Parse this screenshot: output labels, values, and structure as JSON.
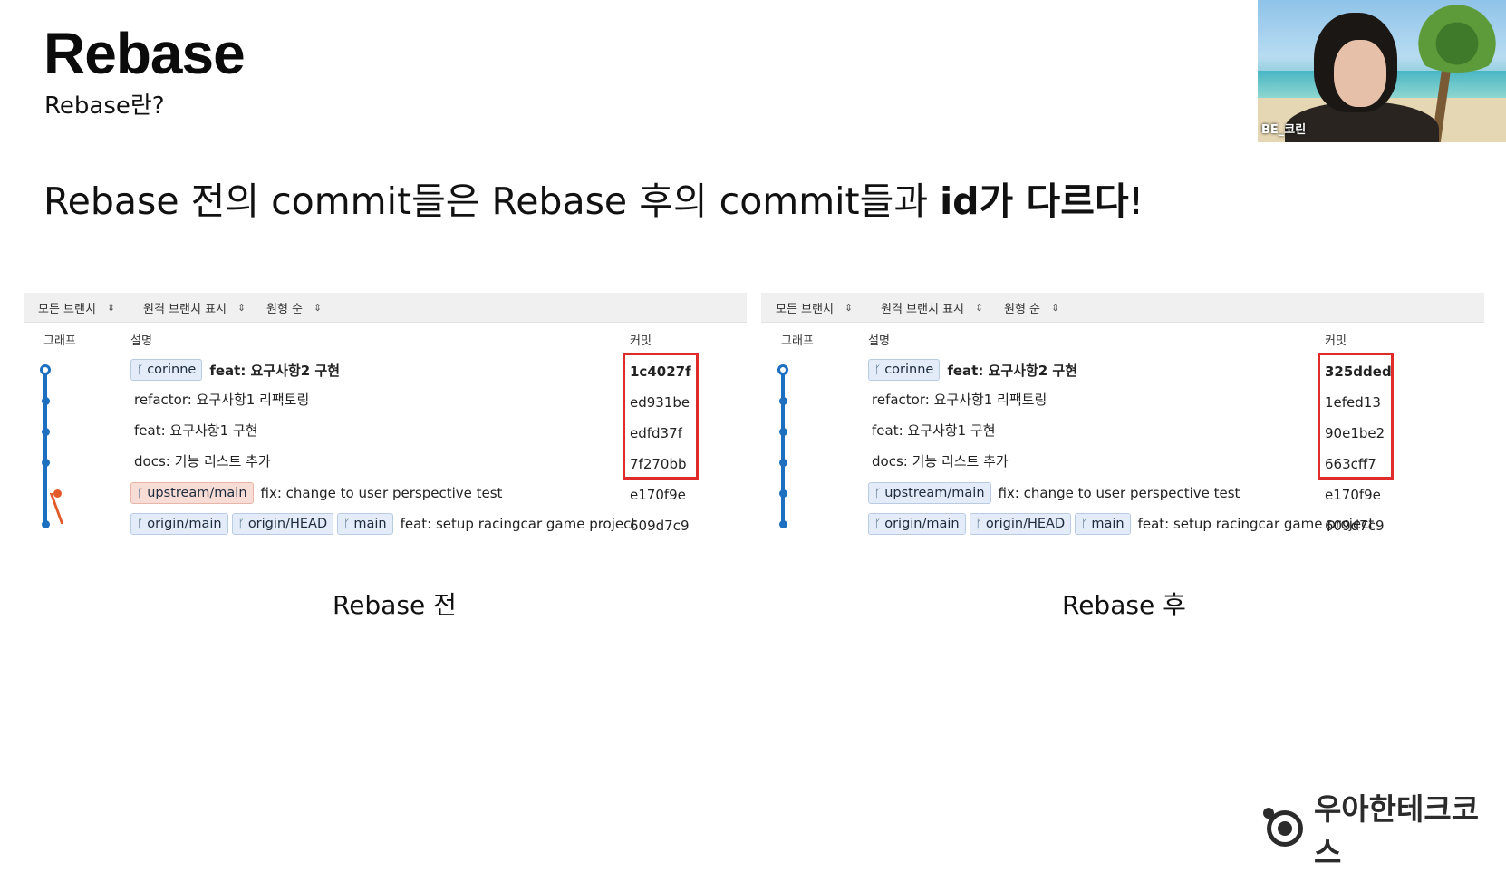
{
  "slide": {
    "title": "Rebase",
    "subtitle": "Rebase란?",
    "headline_prefix": "Rebase 전의 commit들은 Rebase 후의 commit들과 ",
    "headline_emphasis": "id가 다르다",
    "headline_suffix": "!"
  },
  "video": {
    "participant_name": "BE_코린"
  },
  "panels": [
    {
      "caption": "Rebase 전",
      "toolbar": {
        "branches": "모든 브랜치",
        "remote": "원격 브랜치 표시",
        "order": "원형 순"
      },
      "columns": {
        "graph": "그래프",
        "description": "설명",
        "commit": "커밋"
      },
      "rows": [
        {
          "refs": [
            "corinne"
          ],
          "ref_kind": "local",
          "message": "feat: 요구사항2 구현",
          "hash": "1c4027f",
          "bold": true
        },
        {
          "refs": [],
          "message": "refactor: 요구사항1 리팩토링",
          "hash": "ed931be",
          "bold": false
        },
        {
          "refs": [],
          "message": "feat: 요구사항1 구현",
          "hash": "edfd37f",
          "bold": false
        },
        {
          "refs": [],
          "message": "docs: 기능 리스트 추가",
          "hash": "7f270bb",
          "bold": false
        },
        {
          "refs": [
            "upstream/main"
          ],
          "ref_kind": "upstream",
          "message": "fix: change to user perspective test",
          "hash": "e170f9e",
          "bold": false
        },
        {
          "refs": [
            "origin/main",
            "origin/HEAD",
            "main"
          ],
          "ref_kind": "remote",
          "message": "feat: setup racingcar game project",
          "hash": "609d7c9",
          "bold": false
        }
      ]
    },
    {
      "caption": "Rebase 후",
      "toolbar": {
        "branches": "모든 브랜치",
        "remote": "원격 브랜치 표시",
        "order": "원형 순"
      },
      "columns": {
        "graph": "그래프",
        "description": "설명",
        "commit": "커밋"
      },
      "rows": [
        {
          "refs": [
            "corinne"
          ],
          "ref_kind": "local",
          "message": "feat: 요구사항2 구현",
          "hash": "325dded",
          "bold": true
        },
        {
          "refs": [],
          "message": "refactor: 요구사항1 리팩토링",
          "hash": "1efed13",
          "bold": false
        },
        {
          "refs": [],
          "message": "feat: 요구사항1 구현",
          "hash": "90e1be2",
          "bold": false
        },
        {
          "refs": [],
          "message": "docs: 기능 리스트 추가",
          "hash": "663cff7",
          "bold": false
        },
        {
          "refs": [
            "upstream/main"
          ],
          "ref_kind": "remote",
          "message": "fix: change to user perspective test",
          "hash": "e170f9e",
          "bold": false
        },
        {
          "refs": [
            "origin/main",
            "origin/HEAD",
            "main"
          ],
          "ref_kind": "remote",
          "message": "feat: setup racingcar game project",
          "hash": "609d7c9",
          "bold": false
        }
      ]
    }
  ],
  "logo": {
    "text": "우아한테크코스"
  },
  "colors": {
    "graph_line": "#1d6fc0",
    "upstream_node": "#e25a2c",
    "highlight_box": "#e02b2b",
    "chip_bg": "#e3ecf8",
    "chip_upstream_bg": "#f8dcd6"
  }
}
